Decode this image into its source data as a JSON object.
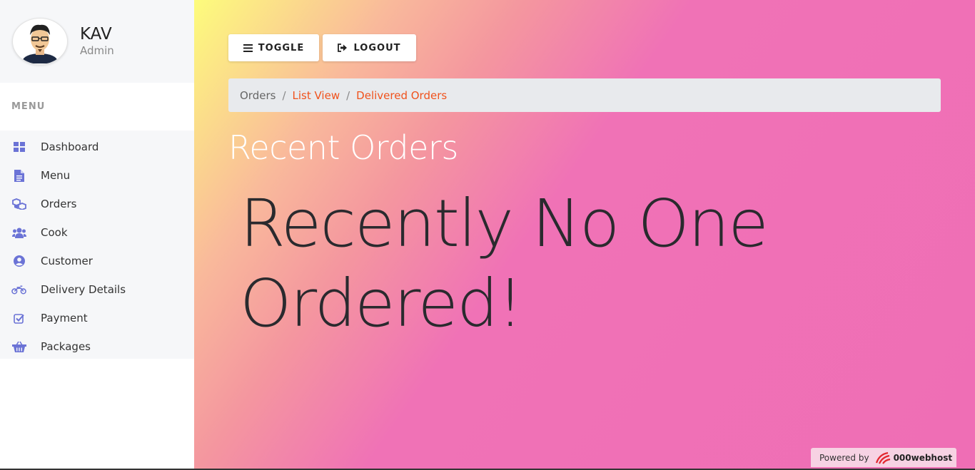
{
  "user": {
    "name": "KAV",
    "role": "Admin"
  },
  "sidebar": {
    "menu_header": "MENU",
    "items": [
      {
        "label": "Dashboard",
        "icon": "dashboard-icon"
      },
      {
        "label": "Menu",
        "icon": "document-icon"
      },
      {
        "label": "Orders",
        "icon": "cubes-icon"
      },
      {
        "label": "Cook",
        "icon": "users-icon"
      },
      {
        "label": "Customer",
        "icon": "user-circle-icon"
      },
      {
        "label": "Delivery Details",
        "icon": "motorcycle-icon"
      },
      {
        "label": "Payment",
        "icon": "check-square-icon"
      },
      {
        "label": "Packages",
        "icon": "basket-icon"
      }
    ]
  },
  "toolbar": {
    "toggle_label": "TOGGLE",
    "logout_label": "LOGOUT"
  },
  "breadcrumb": {
    "root": "Orders",
    "item1": "List View",
    "item2": "Delivered Orders"
  },
  "main": {
    "title": "Recent Orders",
    "message": "Recently No One Ordered!"
  },
  "footer": {
    "powered_by": "Powered by",
    "brand": "000webhost"
  },
  "colors": {
    "accent": "#6b73d6",
    "link": "#f0521c",
    "gradient_start": "#fdfc7c",
    "gradient_end": "#ef6eb5"
  }
}
